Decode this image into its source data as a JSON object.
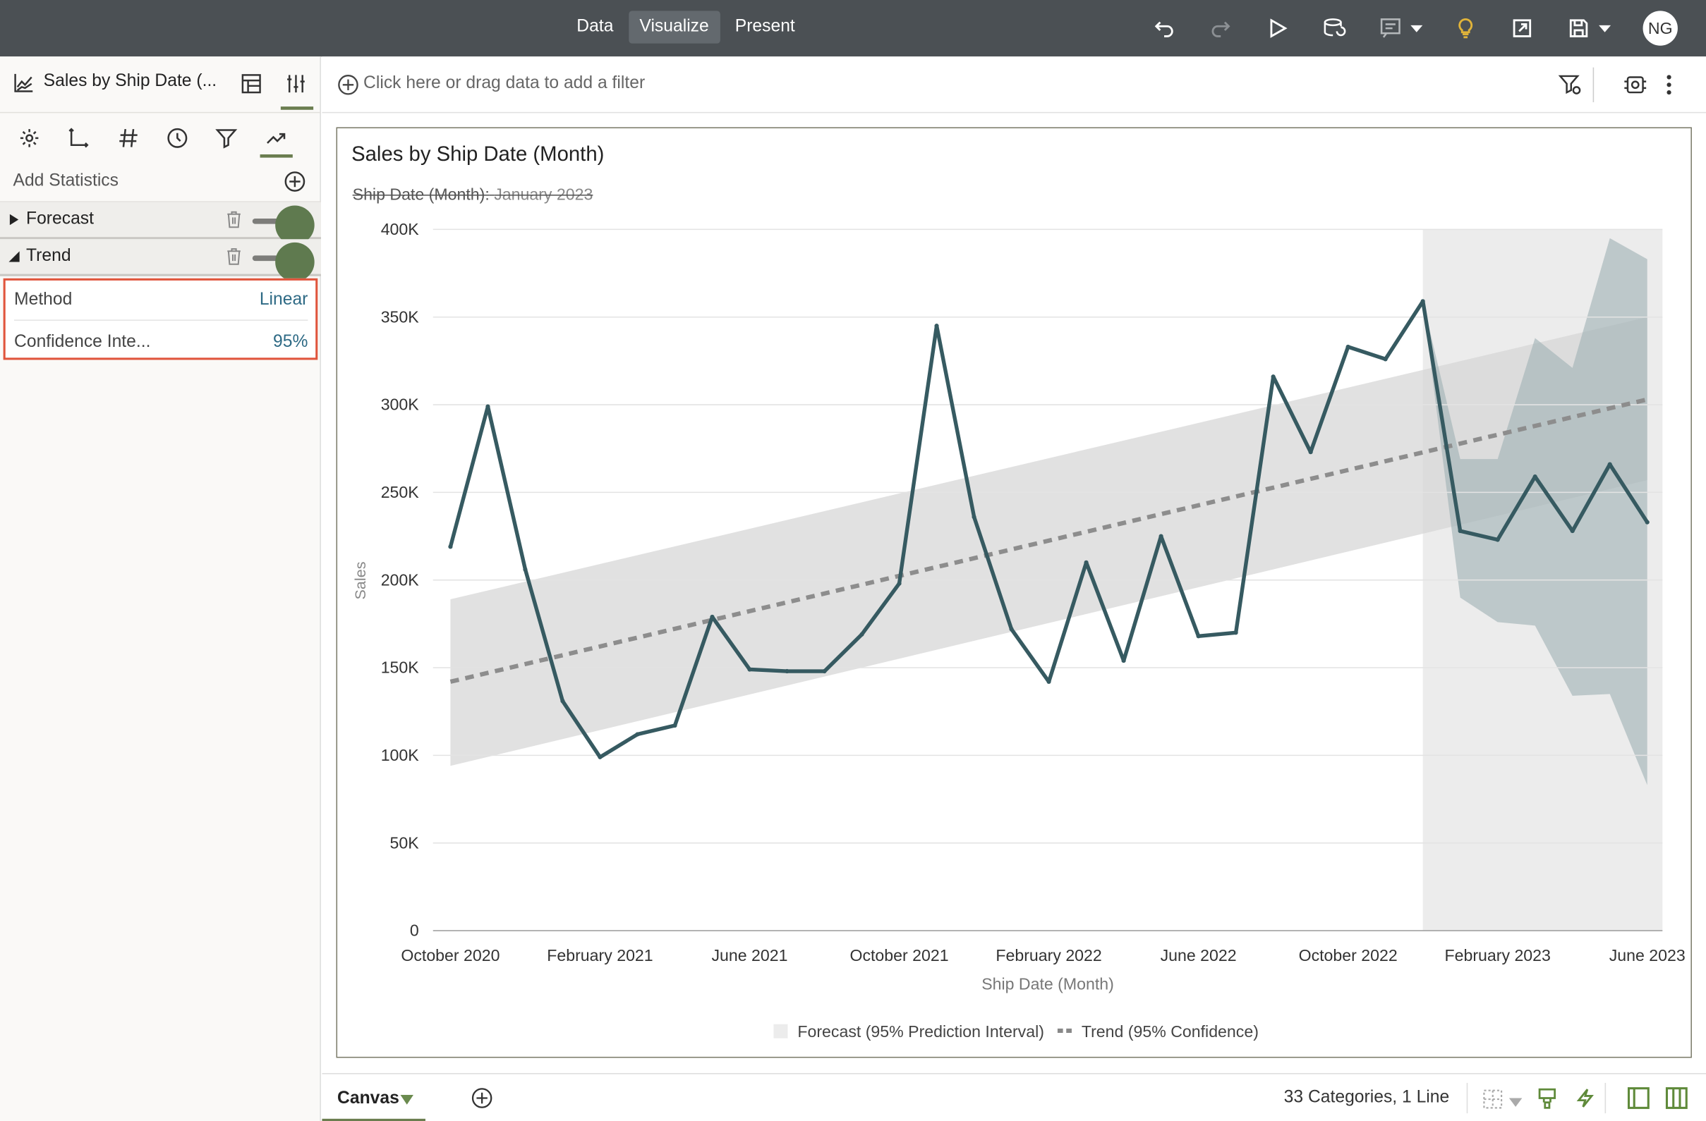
{
  "topbar": {
    "tabs": [
      {
        "label": "Data",
        "active": false
      },
      {
        "label": "Visualize",
        "active": true
      },
      {
        "label": "Present",
        "active": false
      }
    ],
    "user_initials": "NG",
    "icons": [
      "undo-icon",
      "redo-icon",
      "play-icon",
      "refresh-data-icon",
      "comment-icon",
      "lightbulb-icon",
      "export-icon",
      "save-icon"
    ]
  },
  "left_panel": {
    "title": "Sales by Ship Date (...",
    "add_statistics_label": "Add Statistics",
    "sections": [
      {
        "label": "Forecast",
        "expanded": false,
        "enabled": true
      },
      {
        "label": "Trend",
        "expanded": true,
        "enabled": true
      }
    ],
    "trend_properties": [
      {
        "key": "Method",
        "value": "Linear"
      },
      {
        "key": "Confidence Inte...",
        "value": "95%"
      }
    ]
  },
  "filter_bar": {
    "placeholder": "Click here or drag data to add a filter"
  },
  "chart": {
    "title": "Sales by Ship Date (Month)",
    "filter_label": "Ship Date (Month):",
    "filter_value": "January 2023",
    "legend": [
      {
        "label": "Forecast (95% Prediction Interval)"
      },
      {
        "label": "Trend (95% Confidence)"
      }
    ]
  },
  "chart_data": {
    "type": "line",
    "xlabel": "Ship Date (Month)",
    "ylabel": "Sales",
    "ylim": [
      0,
      400000
    ],
    "yticks": [
      "0",
      "50K",
      "100K",
      "150K",
      "200K",
      "250K",
      "300K",
      "350K",
      "400K"
    ],
    "xticks": [
      "October 2020",
      "February 2021",
      "June 2021",
      "October 2021",
      "February 2022",
      "June 2022",
      "October 2022",
      "February 2023",
      "June 2023"
    ],
    "x": [
      "Oct 2020",
      "Nov 2020",
      "Dec 2020",
      "Jan 2021",
      "Feb 2021",
      "Mar 2021",
      "Apr 2021",
      "May 2021",
      "Jun 2021",
      "Jul 2021",
      "Aug 2021",
      "Sep 2021",
      "Oct 2021",
      "Nov 2021",
      "Dec 2021",
      "Jan 2022",
      "Feb 2022",
      "Mar 2022",
      "Apr 2022",
      "May 2022",
      "Jun 2022",
      "Jul 2022",
      "Aug 2022",
      "Sep 2022",
      "Oct 2022",
      "Nov 2022",
      "Dec 2022",
      "Jan 2023",
      "Feb 2023",
      "Mar 2023",
      "Apr 2023",
      "May 2023",
      "Jun 2023"
    ],
    "series": [
      {
        "values": [
          219000,
          299000,
          206000,
          131000,
          99000,
          112000,
          117000,
          179000,
          149000,
          148000,
          148000,
          169000,
          198000,
          345000,
          236000,
          172000,
          142000,
          210000,
          154000,
          225000,
          168000,
          170000,
          316000,
          273000,
          333000,
          326000,
          359000,
          228000,
          223000,
          259000,
          228000,
          266000,
          233000
        ]
      }
    ],
    "trend": {
      "start": 142000,
      "end": 303000,
      "band_start": [
        94000,
        189000
      ],
      "band_end": [
        257000,
        350000
      ]
    },
    "forecast": {
      "start_index": 26,
      "upper": [
        359000,
        269000,
        269000,
        338000,
        321000,
        395000,
        383000
      ],
      "lower": [
        359000,
        190000,
        176000,
        174000,
        134000,
        135000,
        83000
      ]
    },
    "grid": true,
    "legend_position": "bottom"
  },
  "bottom_bar": {
    "canvas_label": "Canvas",
    "status": "33 Categories, 1 Line"
  }
}
